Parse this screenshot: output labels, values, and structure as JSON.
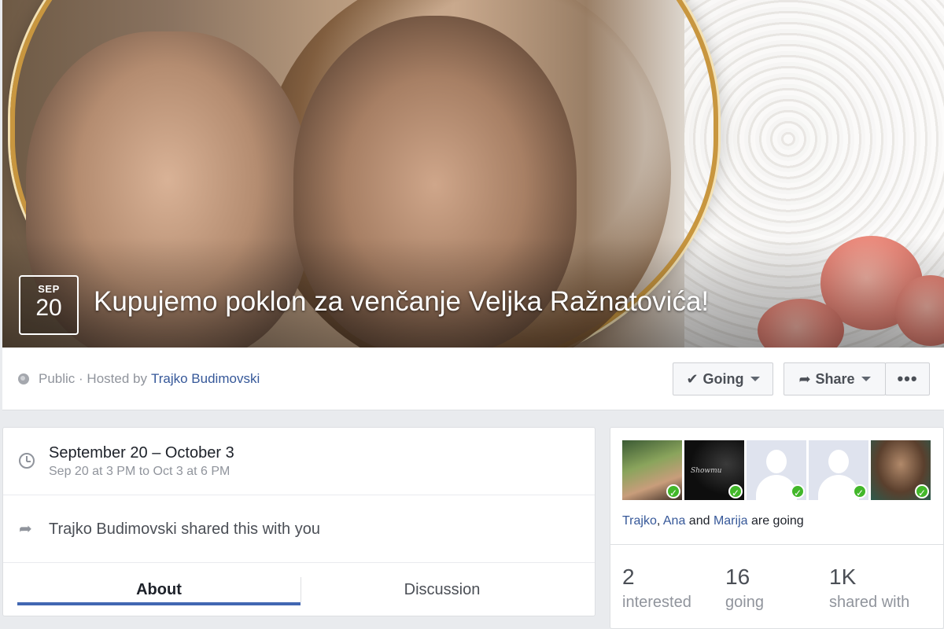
{
  "event": {
    "month": "SEP",
    "day": "20",
    "title": "Kupujemo poklon za venčanje Veljka Ražnatovića!"
  },
  "host": {
    "privacy": "Public",
    "hosted_by_prefix": "· Hosted by",
    "host_name": "Trajko Budimovski"
  },
  "actions": {
    "going_label": "Going",
    "share_label": "Share",
    "more_label": "•••"
  },
  "details": {
    "date_range": "September 20 – October 3",
    "time_range": "Sep 20 at 3 PM to Oct 3 at 6 PM",
    "shared_note": "Trajko Budimovski shared this with you"
  },
  "tabs": [
    {
      "label": "About"
    },
    {
      "label": "Discussion"
    }
  ],
  "guests": {
    "avatar_tag": "Showmu",
    "name1": "Trajko",
    "sep1": ",",
    "name2": "Ana",
    "and": "and",
    "name3": "Marija",
    "suffix": "are going"
  },
  "stats": [
    {
      "value": "2",
      "label": "interested"
    },
    {
      "value": "16",
      "label": "going"
    },
    {
      "value": "1K",
      "label": "shared with"
    }
  ],
  "colors": {
    "link": "#365899",
    "accent": "#4267b2",
    "going_check": "#42b72a"
  }
}
